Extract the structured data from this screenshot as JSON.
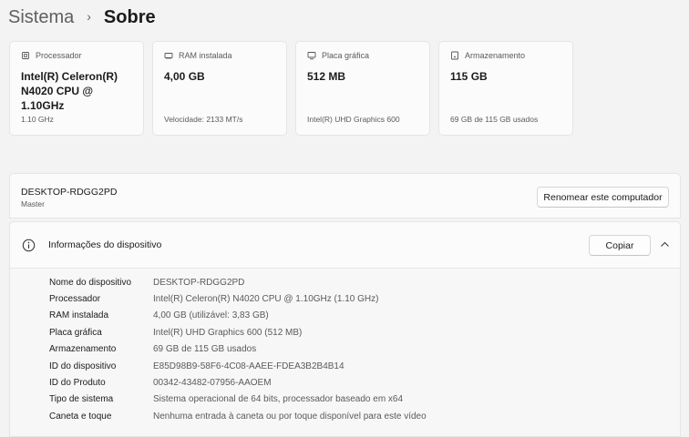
{
  "breadcrumb": {
    "parent": "Sistema",
    "separator": "›",
    "current": "Sobre"
  },
  "cards": [
    {
      "icon": "processor-icon",
      "label": "Processador",
      "value": "Intel(R) Celeron(R) N4020 CPU @ 1.10GHz",
      "sub": "1.10 GHz"
    },
    {
      "icon": "ram-icon",
      "label": "RAM instalada",
      "value": "4,00 GB",
      "sub": "Velocidade: 2133 MT/s"
    },
    {
      "icon": "graphics-card-icon",
      "label": "Placa gráfica",
      "value": "512 MB",
      "sub": "Intel(R) UHD Graphics 600"
    },
    {
      "icon": "storage-icon",
      "label": "Armazenamento",
      "value": "115 GB",
      "sub": "69 GB de 115 GB usados"
    }
  ],
  "device": {
    "name": "DESKTOP-RDGG2PD",
    "subtitle": "Master",
    "rename_label": "Renomear este computador"
  },
  "specs": {
    "title": "Informações do dispositivo",
    "copy_label": "Copiar",
    "rows": [
      {
        "label": "Nome do dispositivo",
        "value": "DESKTOP-RDGG2PD"
      },
      {
        "label": "Processador",
        "value": "Intel(R) Celeron(R) N4020 CPU @ 1.10GHz (1.10 GHz)"
      },
      {
        "label": "RAM instalada",
        "value": "4,00 GB (utilizável: 3,83 GB)"
      },
      {
        "label": "Placa gráfica",
        "value": "Intel(R) UHD Graphics 600 (512 MB)"
      },
      {
        "label": "Armazenamento",
        "value": "69 GB de 115 GB usados"
      },
      {
        "label": "ID do dispositivo",
        "value": "E85D98B9-58F6-4C08-AAEE-FDEA3B2B4B14"
      },
      {
        "label": "ID do Produto",
        "value": "00342-43482-07956-AAOEM"
      },
      {
        "label": "Tipo de sistema",
        "value": "Sistema operacional de 64 bits, processador baseado em x64"
      },
      {
        "label": "Caneta e toque",
        "value": "Nenhuma entrada à caneta ou por toque disponível para este vídeo"
      }
    ]
  }
}
